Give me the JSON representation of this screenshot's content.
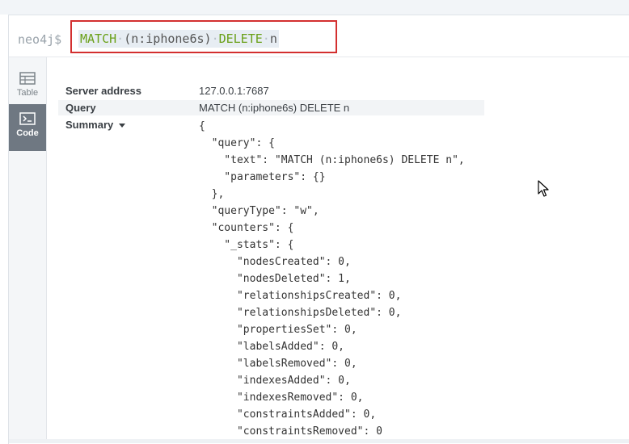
{
  "editor": {
    "prompt": "neo4j$",
    "command_keyword_1": "MATCH",
    "command_pattern": "(n:iphone6s)",
    "command_keyword_2": "DELETE",
    "command_var": "n"
  },
  "sidebar": {
    "tabs": [
      {
        "label": "Table",
        "icon": "table-icon",
        "active": false
      },
      {
        "label": "Code",
        "icon": "code-icon",
        "active": true
      }
    ]
  },
  "summary": {
    "server_address_label": "Server address",
    "server_address_value": "127.0.0.1:7687",
    "query_label": "Query",
    "query_value": "MATCH (n:iphone6s) DELETE n",
    "summary_label": "Summary"
  },
  "json_lines": [
    "{",
    "  \"query\": {",
    "    \"text\": \"MATCH (n:iphone6s) DELETE n\",",
    "    \"parameters\": {}",
    "  },",
    "  \"queryType\": \"w\",",
    "  \"counters\": {",
    "    \"_stats\": {",
    "      \"nodesCreated\": 0,",
    "      \"nodesDeleted\": 1,",
    "      \"relationshipsCreated\": 0,",
    "      \"relationshipsDeleted\": 0,",
    "      \"propertiesSet\": 0,",
    "      \"labelsAdded\": 0,",
    "      \"labelsRemoved\": 0,",
    "      \"indexesAdded\": 0,",
    "      \"indexesRemoved\": 0,",
    "      \"constraintsAdded\": 0,",
    "      \"constraintsRemoved\": 0"
  ],
  "colors": {
    "keyword": "#6aa018",
    "highlight_border": "#d32f2f",
    "active_tab": "#6f7882"
  }
}
